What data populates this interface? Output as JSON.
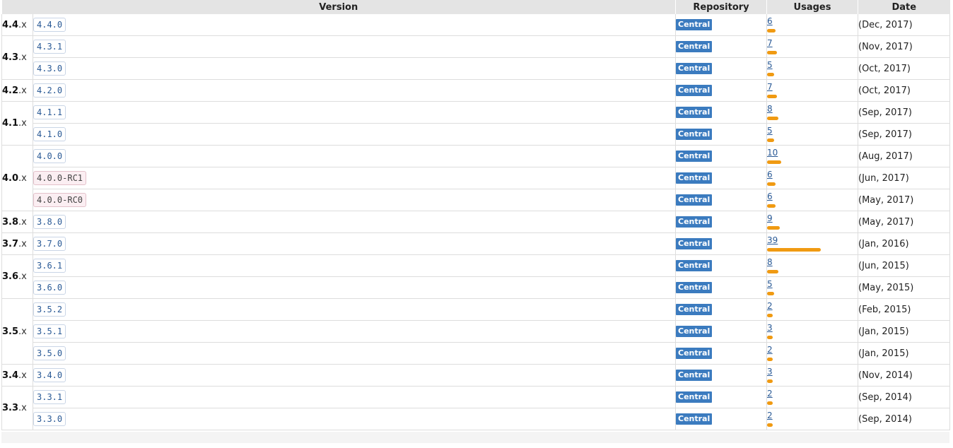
{
  "headers": {
    "version": "Version",
    "repository": "Repository",
    "usages": "Usages",
    "date": "Date"
  },
  "groups": [
    {
      "minor": "4.4",
      "x": ".x",
      "rows": [
        {
          "version": "4.4.0",
          "pre": false,
          "repo": "Central",
          "usages": "6",
          "date": "(Dec, 2017)"
        }
      ]
    },
    {
      "minor": "4.3",
      "x": ".x",
      "rows": [
        {
          "version": "4.3.1",
          "pre": false,
          "repo": "Central",
          "usages": "7",
          "date": "(Nov, 2017)"
        },
        {
          "version": "4.3.0",
          "pre": false,
          "repo": "Central",
          "usages": "5",
          "date": "(Oct, 2017)"
        }
      ]
    },
    {
      "minor": "4.2",
      "x": ".x",
      "rows": [
        {
          "version": "4.2.0",
          "pre": false,
          "repo": "Central",
          "usages": "7",
          "date": "(Oct, 2017)"
        }
      ]
    },
    {
      "minor": "4.1",
      "x": ".x",
      "rows": [
        {
          "version": "4.1.1",
          "pre": false,
          "repo": "Central",
          "usages": "8",
          "date": "(Sep, 2017)"
        },
        {
          "version": "4.1.0",
          "pre": false,
          "repo": "Central",
          "usages": "5",
          "date": "(Sep, 2017)"
        }
      ]
    },
    {
      "minor": "4.0",
      "x": ".x",
      "rows": [
        {
          "version": "4.0.0",
          "pre": false,
          "repo": "Central",
          "usages": "10",
          "date": "(Aug, 2017)"
        },
        {
          "version": "4.0.0-RC1",
          "pre": true,
          "repo": "Central",
          "usages": "6",
          "date": "(Jun, 2017)"
        },
        {
          "version": "4.0.0-RC0",
          "pre": true,
          "repo": "Central",
          "usages": "6",
          "date": "(May, 2017)"
        }
      ]
    },
    {
      "minor": "3.8",
      "x": ".x",
      "rows": [
        {
          "version": "3.8.0",
          "pre": false,
          "repo": "Central",
          "usages": "9",
          "date": "(May, 2017)"
        }
      ]
    },
    {
      "minor": "3.7",
      "x": ".x",
      "rows": [
        {
          "version": "3.7.0",
          "pre": false,
          "repo": "Central",
          "usages": "39",
          "date": "(Jan, 2016)"
        }
      ]
    },
    {
      "minor": "3.6",
      "x": ".x",
      "rows": [
        {
          "version": "3.6.1",
          "pre": false,
          "repo": "Central",
          "usages": "8",
          "date": "(Jun, 2015)"
        },
        {
          "version": "3.6.0",
          "pre": false,
          "repo": "Central",
          "usages": "5",
          "date": "(May, 2015)"
        }
      ]
    },
    {
      "minor": "3.5",
      "x": ".x",
      "rows": [
        {
          "version": "3.5.2",
          "pre": false,
          "repo": "Central",
          "usages": "2",
          "date": "(Feb, 2015)"
        },
        {
          "version": "3.5.1",
          "pre": false,
          "repo": "Central",
          "usages": "3",
          "date": "(Jan, 2015)"
        },
        {
          "version": "3.5.0",
          "pre": false,
          "repo": "Central",
          "usages": "2",
          "date": "(Jan, 2015)"
        }
      ]
    },
    {
      "minor": "3.4",
      "x": ".x",
      "rows": [
        {
          "version": "3.4.0",
          "pre": false,
          "repo": "Central",
          "usages": "3",
          "date": "(Nov, 2014)"
        }
      ]
    },
    {
      "minor": "3.3",
      "x": ".x",
      "rows": [
        {
          "version": "3.3.1",
          "pre": false,
          "repo": "Central",
          "usages": "2",
          "date": "(Sep, 2014)"
        },
        {
          "version": "3.3.0",
          "pre": false,
          "repo": "Central",
          "usages": "2",
          "date": "(Sep, 2014)"
        }
      ]
    }
  ],
  "colors": {
    "usage_bar": "#f09a12",
    "central_badge": "#3b7bbf",
    "link": "#2a5a96",
    "prerelease_bg": "#fbeef2"
  }
}
